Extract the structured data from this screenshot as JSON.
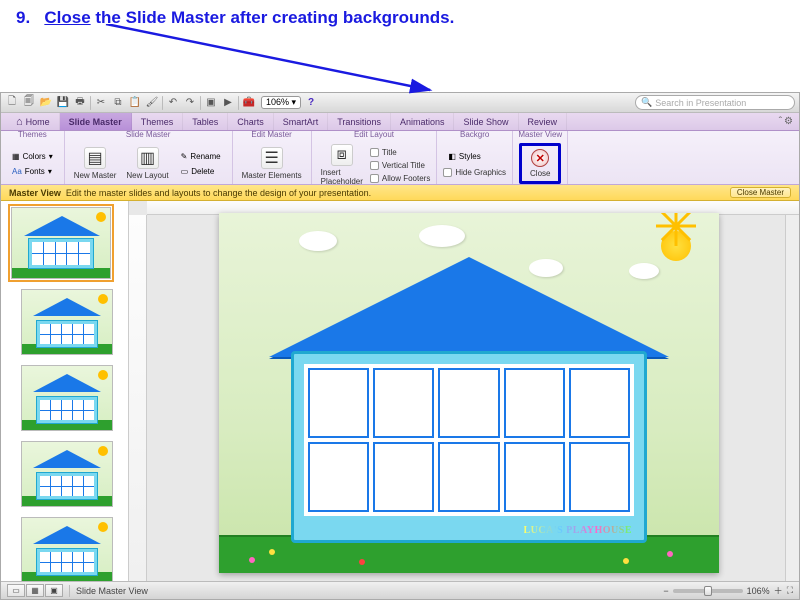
{
  "instruction": {
    "number": "9.",
    "word_underlined": "Close",
    "rest": " the Slide Master after creating backgrounds."
  },
  "toolbar": {
    "zoom_value": "106%"
  },
  "search": {
    "placeholder": "Search in Presentation"
  },
  "tabs": [
    "Home",
    "Slide Master",
    "Themes",
    "Tables",
    "Charts",
    "SmartArt",
    "Transitions",
    "Animations",
    "Slide Show",
    "Review"
  ],
  "active_tab_index": 1,
  "ribbon_groups": {
    "themes": {
      "title": "Themes",
      "colors_label": "Colors",
      "fonts_label": "Fonts"
    },
    "slide_master": {
      "title": "Slide Master",
      "new_master": "New Master",
      "new_layout": "New Layout",
      "rename": "Rename",
      "delete": "Delete"
    },
    "edit_master": {
      "title": "Edit Master",
      "master_elements": "Master Elements"
    },
    "edit_layout": {
      "title": "Edit Layout",
      "insert_placeholder": "Insert\nPlaceholder",
      "opt_title": "Title",
      "opt_vertical_title": "Vertical Title",
      "opt_allow_footers": "Allow Footers"
    },
    "background": {
      "title": "Backgro",
      "styles": "Styles",
      "hide_graphics": "Hide Graphics"
    },
    "master_view": {
      "title": "Master View",
      "close": "Close"
    }
  },
  "info_bar": {
    "label": "Master View",
    "message": "Edit the master slides and layouts to change the design of your presentation.",
    "close_button": "Close Master"
  },
  "slide_content": {
    "house_label": "LUCA'S PLAYHOUSE"
  },
  "status": {
    "mode": "Slide Master View",
    "zoom": "106%"
  }
}
